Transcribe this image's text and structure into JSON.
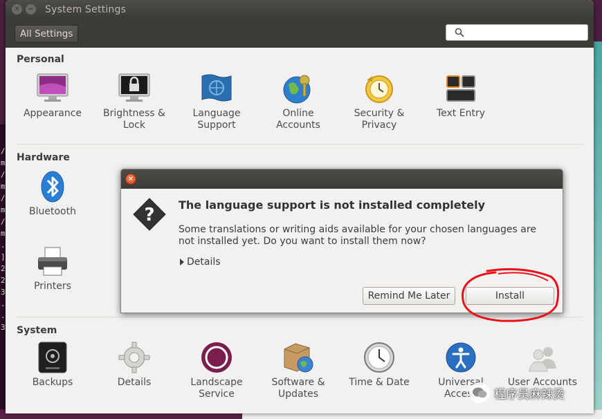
{
  "window": {
    "title": "System Settings",
    "all_settings_label": "All Settings",
    "search_placeholder": ""
  },
  "sections": {
    "personal": {
      "title": "Personal",
      "items": [
        {
          "label": "Appearance",
          "icon": "appearance-icon"
        },
        {
          "label": "Brightness & Lock",
          "icon": "brightness-lock-icon"
        },
        {
          "label": "Language Support",
          "icon": "language-support-icon"
        },
        {
          "label": "Online Accounts",
          "icon": "online-accounts-icon"
        },
        {
          "label": "Security & Privacy",
          "icon": "security-privacy-icon"
        },
        {
          "label": "Text Entry",
          "icon": "text-entry-icon"
        }
      ]
    },
    "hardware": {
      "title": "Hardware",
      "items": [
        {
          "label": "Bluetooth",
          "icon": "bluetooth-icon"
        },
        {
          "label": "Printers",
          "icon": "printer-icon"
        }
      ]
    },
    "system": {
      "title": "System",
      "items": [
        {
          "label": "Backups",
          "icon": "backups-icon"
        },
        {
          "label": "Details",
          "icon": "gear-icon"
        },
        {
          "label": "Landscape Service",
          "icon": "landscape-icon"
        },
        {
          "label": "Software & Updates",
          "icon": "software-updates-icon"
        },
        {
          "label": "Time & Date",
          "icon": "clock-icon"
        },
        {
          "label": "Universal Access",
          "icon": "universal-access-icon"
        },
        {
          "label": "User Accounts",
          "icon": "user-accounts-icon"
        }
      ]
    }
  },
  "dialog": {
    "heading": "The language support is not installed completely",
    "message": "Some translations or writing aids available for your chosen languages are not installed yet. Do you want to install them now?",
    "details_label": "Details",
    "remind_label": "Remind Me Later",
    "install_label": "Install"
  },
  "terminal_chars": [
    "/",
    "m",
    "/",
    "m",
    "/",
    "m",
    "/",
    "m",
    ".",
    "]",
    "2",
    "2",
    "3",
    ".",
    ".",
    "3"
  ],
  "watermark": {
    "text": "程序员麻辣烫"
  },
  "colors": {
    "titlebar": "#3c3b37",
    "window_bg": "#f2f1f0",
    "annotation_red": "#e8101a",
    "close_orange": "#e05a2c"
  }
}
